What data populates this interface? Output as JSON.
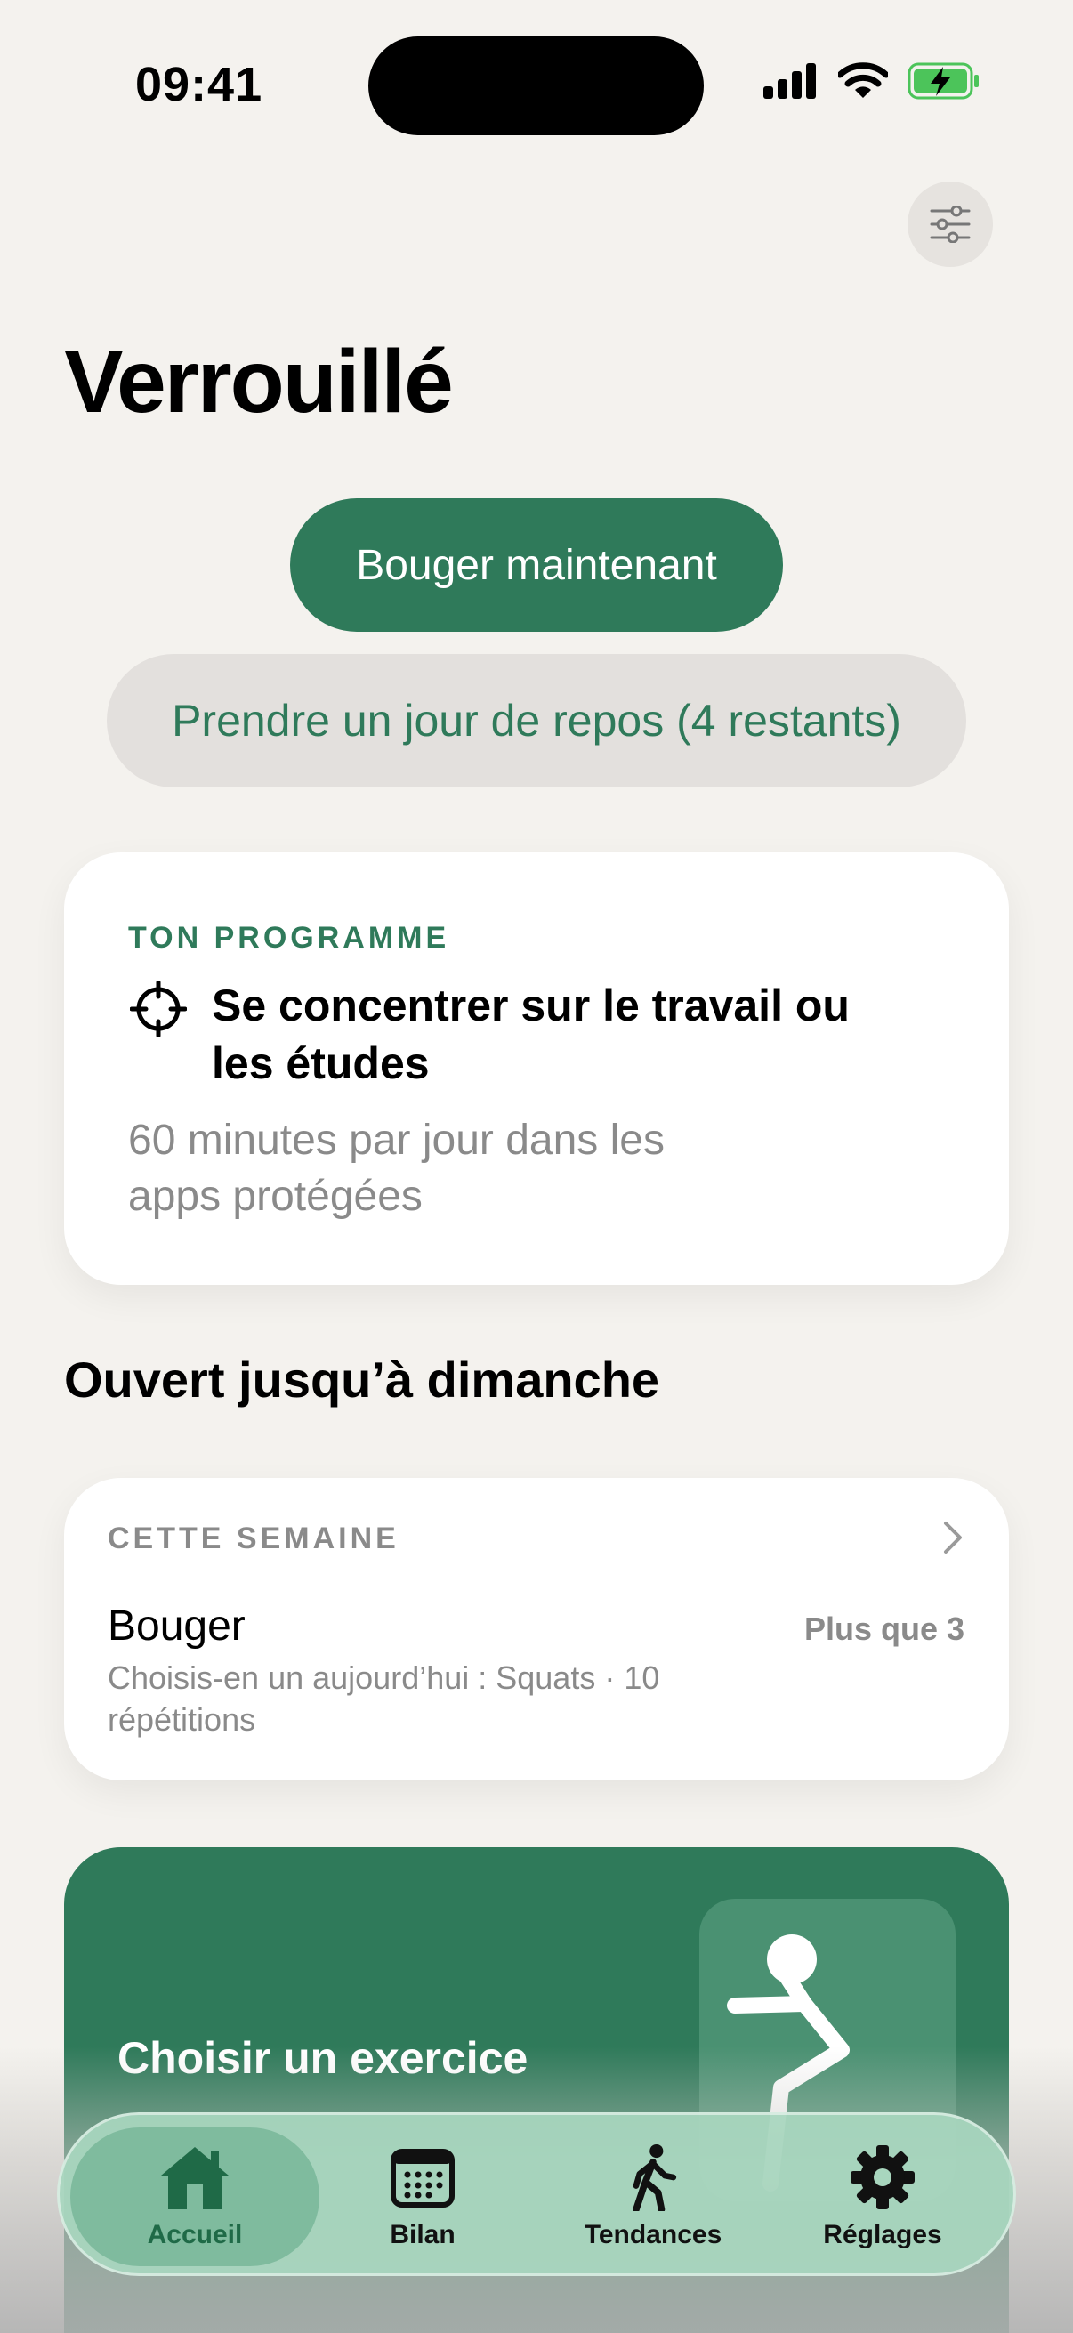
{
  "status_bar": {
    "time": "09:41"
  },
  "header": {
    "title": "Verrouillé"
  },
  "actions": {
    "move_now": "Bouger maintenant",
    "rest_day": "Prendre un jour de repos (4 restants)"
  },
  "program": {
    "label": "TON PROGRAMME",
    "title": "Se concentrer sur le travail ou les études",
    "description": "60 minutes par jour dans les apps protégées"
  },
  "open_until": "Ouvert jusqu’à dimanche",
  "week": {
    "label": "CETTE SEMAINE",
    "title": "Bouger",
    "count": "Plus que 3",
    "description": "Choisis-en un aujourd’hui : Squats · 10 répétitions"
  },
  "exercise": {
    "label": "Choisir un exercice"
  },
  "tabs": [
    {
      "label": "Accueil",
      "icon": "home-icon",
      "active": true
    },
    {
      "label": "Bilan",
      "icon": "calendar-icon",
      "active": false
    },
    {
      "label": "Tendances",
      "icon": "walking-icon",
      "active": false
    },
    {
      "label": "Réglages",
      "icon": "gear-icon",
      "active": false
    }
  ],
  "colors": {
    "accent": "#2f7a5a",
    "background": "#f4f2ee",
    "tabbar": "#a8d6be"
  }
}
